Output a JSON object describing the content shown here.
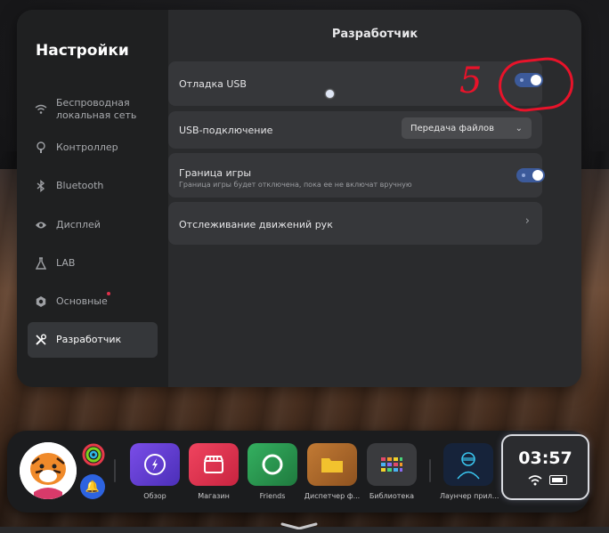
{
  "sidebar": {
    "title": "Настройки",
    "items": [
      {
        "label": "Беспроводная локальная сеть",
        "icon": "wifi-icon",
        "active": false
      },
      {
        "label": "Контроллер",
        "icon": "controller-icon",
        "active": false
      },
      {
        "label": "Bluetooth",
        "icon": "bluetooth-icon",
        "active": false
      },
      {
        "label": "Дисплей",
        "icon": "eye-icon",
        "active": false
      },
      {
        "label": "LAB",
        "icon": "flask-icon",
        "active": false
      },
      {
        "label": "Основные",
        "icon": "gear-icon",
        "active": false
      },
      {
        "label": "Разработчик",
        "icon": "tools-icon",
        "active": true
      }
    ]
  },
  "content": {
    "title": "Разработчик",
    "rows": [
      {
        "label": "Отладка USB",
        "type": "toggle",
        "on": true
      },
      {
        "label": "USB-подключение",
        "type": "select",
        "value": "Передача файлов"
      },
      {
        "label": "Граница игры",
        "sublabel": "Граница игры будет отключена, пока ее не включат вручную",
        "type": "toggle",
        "on": true
      },
      {
        "label": "Отслеживание движений рук",
        "type": "link"
      }
    ]
  },
  "annotation": {
    "number": "5",
    "color": "#e8132a"
  },
  "taskbar": {
    "apps": [
      {
        "label": "Обзор",
        "icon": "explore-icon",
        "color": "#6b3fd6"
      },
      {
        "label": "Магазин",
        "icon": "store-icon",
        "color": "#e0334f"
      },
      {
        "label": "Friends",
        "icon": "friends-icon",
        "color": "#2f9a52"
      },
      {
        "label": "Диспетчер ф...",
        "icon": "folder-icon",
        "color": "#b06a2a"
      },
      {
        "label": "Библиотека",
        "icon": "library-icon",
        "color": "#3a3b3e"
      },
      {
        "label": "Лаунчер прил...",
        "icon": "launcher-icon",
        "color": "#1c2a3a"
      }
    ],
    "time": "03:57"
  },
  "colors": {
    "accent": "#3c5a9a",
    "panel": "#2a2b2d",
    "sidebar": "#1f2021"
  }
}
